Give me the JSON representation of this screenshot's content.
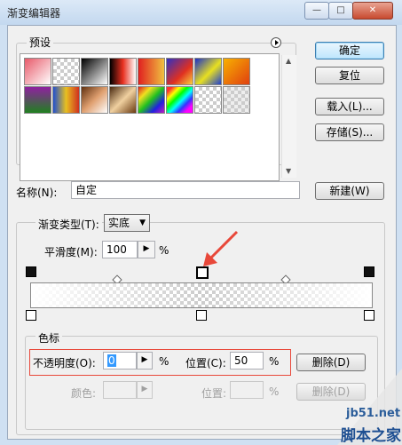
{
  "window": {
    "title": "渐变编辑器",
    "minimize_symbol": "—",
    "maximize_symbol": "□",
    "close_symbol": "✕"
  },
  "presets": {
    "label": "预设",
    "menu_icon": "circle-arrow-right-icon"
  },
  "buttons": {
    "ok": "确定",
    "reset": "复位",
    "load": "载入(L)...",
    "save": "存储(S)...",
    "new": "新建(W)",
    "delete": "删除(D)",
    "delete_disabled": "删除(D)"
  },
  "name": {
    "label": "名称(N):",
    "value": "自定"
  },
  "gradient_type": {
    "label": "渐变类型(T):",
    "value": "实底"
  },
  "smoothness": {
    "label": "平滑度(M):",
    "value": "100",
    "unit": "%"
  },
  "color_stops": {
    "label": "色标",
    "opacity_label": "不透明度(O):",
    "opacity_value": "0",
    "opacity_unit": "%",
    "position_label": "位置(C):",
    "position_value": "50",
    "position_unit": "%",
    "color_label": "颜色:",
    "color_position_label": "位置:",
    "color_position_unit": "%"
  },
  "watermark": {
    "url": "jb51.net",
    "site": "脚本之家"
  },
  "colors": {
    "accent": "#e8483a",
    "highlight_border": "#e8483a",
    "default_button": "#3c7fb1"
  }
}
